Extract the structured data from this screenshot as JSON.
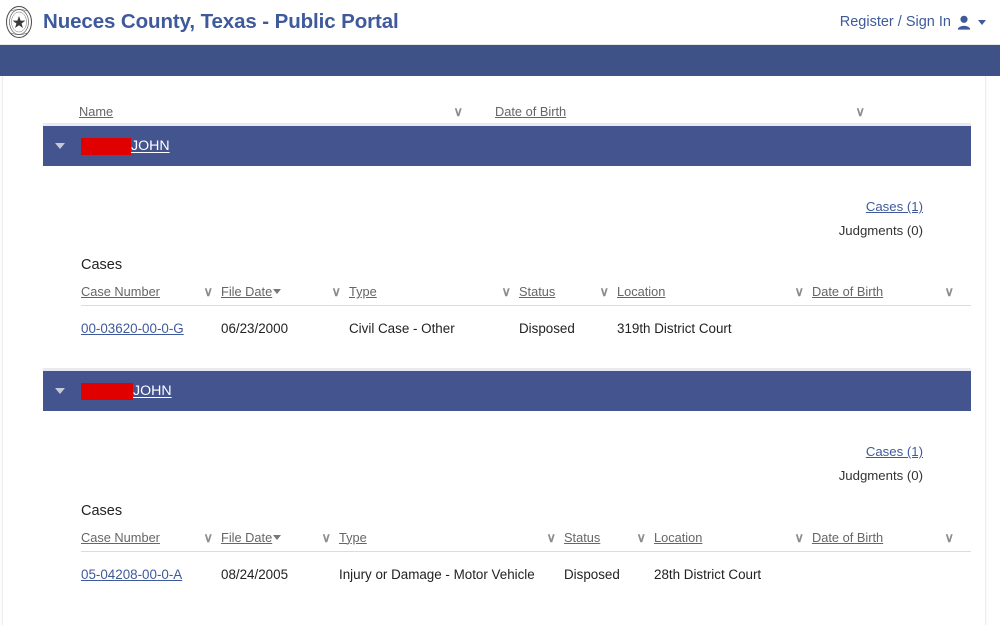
{
  "header": {
    "title": "Nueces County, Texas - Public Portal",
    "seal_icon": "texas-state-seal-icon",
    "account": {
      "label": "Register / Sign In",
      "user_icon": "user-icon",
      "caret_icon": "chevron-down-icon"
    }
  },
  "colors": {
    "brand_blue": "#3f5a9b",
    "nav_navy": "#3e5288",
    "person_row": "#44548f",
    "link": "#3f5a9b",
    "redaction": "#e00000"
  },
  "master_grid": {
    "columns": [
      {
        "label": "Name",
        "filter_icon": "chevron-down-icon"
      },
      {
        "label": "Date of Birth",
        "filter_icon": "chevron-down-icon"
      }
    ]
  },
  "people": [
    {
      "toggle_icon": "triangle-down-icon",
      "redacted": true,
      "name_visible": "JOHN",
      "cases_link": "Cases (1)",
      "judgments_text": "Judgments (0)",
      "cases_section_label": "Cases",
      "table": {
        "columns": [
          {
            "label": "Case Number",
            "filter_icon": "chevron-down-icon",
            "sorted": false
          },
          {
            "label": "File Date",
            "filter_icon": "chevron-down-icon",
            "sorted": true,
            "sort_dir": "desc"
          },
          {
            "label": "Type",
            "filter_icon": "chevron-down-icon",
            "sorted": false
          },
          {
            "label": "Status",
            "filter_icon": "chevron-down-icon",
            "sorted": false
          },
          {
            "label": "Location",
            "filter_icon": "chevron-down-icon",
            "sorted": false
          },
          {
            "label": "Date of Birth",
            "filter_icon": "chevron-down-icon",
            "sorted": false
          }
        ],
        "rows": [
          {
            "case_number": "00-03620-00-0-G",
            "file_date": "06/23/2000",
            "type": "Civil Case - Other",
            "status": "Disposed",
            "location": "319th District Court",
            "date_of_birth": ""
          }
        ]
      }
    },
    {
      "toggle_icon": "triangle-down-icon",
      "redacted": true,
      "name_visible": "JOHN",
      "cases_link": "Cases (1)",
      "judgments_text": "Judgments (0)",
      "cases_section_label": "Cases",
      "table": {
        "columns": [
          {
            "label": "Case Number",
            "filter_icon": "chevron-down-icon",
            "sorted": false
          },
          {
            "label": "File Date",
            "filter_icon": "chevron-down-icon",
            "sorted": true,
            "sort_dir": "desc"
          },
          {
            "label": "Type",
            "filter_icon": "chevron-down-icon",
            "sorted": false
          },
          {
            "label": "Status",
            "filter_icon": "chevron-down-icon",
            "sorted": false
          },
          {
            "label": "Location",
            "filter_icon": "chevron-down-icon",
            "sorted": false
          },
          {
            "label": "Date of Birth",
            "filter_icon": "chevron-down-icon",
            "sorted": false
          }
        ],
        "rows": [
          {
            "case_number": "05-04208-00-0-A",
            "file_date": "08/24/2005",
            "type": "Injury or Damage - Motor Vehicle",
            "status": "Disposed",
            "location": "28th District Court",
            "date_of_birth": ""
          }
        ]
      }
    }
  ],
  "glyphs": {
    "chevron_down": "∨"
  }
}
